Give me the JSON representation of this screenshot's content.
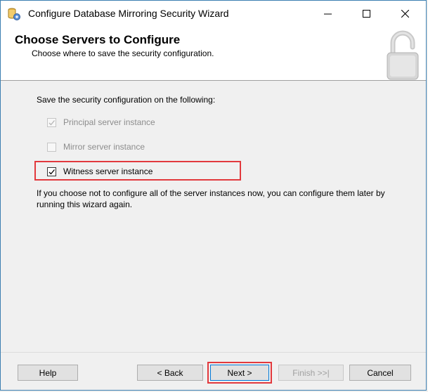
{
  "window": {
    "title": "Configure Database Mirroring Security Wizard",
    "minimize_icon": "minimize-icon",
    "maximize_icon": "maximize-icon",
    "close_icon": "close-icon"
  },
  "header": {
    "title": "Choose Servers to Configure",
    "subtitle": "Choose where to save the security configuration.",
    "icon": "padlock-icon"
  },
  "main": {
    "intro": "Save the security configuration on the following:",
    "options": [
      {
        "label": "Principal server instance",
        "checked": true,
        "enabled": false
      },
      {
        "label": "Mirror server instance",
        "checked": false,
        "enabled": false
      },
      {
        "label": "Witness server instance",
        "checked": true,
        "enabled": true
      }
    ],
    "note": "If you choose not to configure all of the server instances now, you can configure them later by running this wizard again."
  },
  "footer": {
    "help_label": "Help",
    "back_label": "< Back",
    "next_label": "Next >",
    "finish_label": "Finish >>|",
    "cancel_label": "Cancel"
  },
  "colors": {
    "highlight": "#e2393d",
    "title_bar": "#ffffff",
    "dialog_bg": "#f0f0f0"
  }
}
